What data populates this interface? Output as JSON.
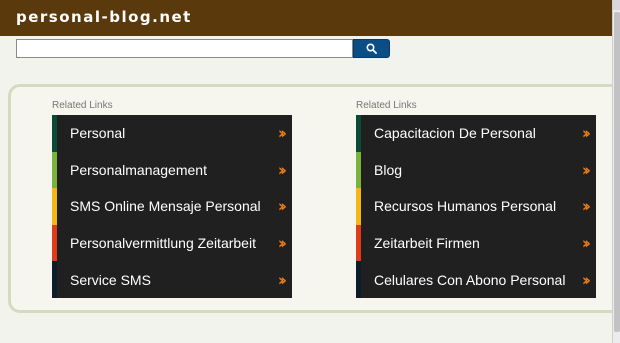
{
  "header": {
    "title": "personal-blog.net"
  },
  "search": {
    "value": "",
    "placeholder": ""
  },
  "colors": {
    "header_bg": "#5a3a0c",
    "search_button": "#0b4e86",
    "link_bg": "#202020",
    "arrow": "#ee7a16"
  },
  "columns": [
    {
      "title": "Related Links",
      "links": [
        {
          "label": "Personal",
          "accent": "#0b4a34"
        },
        {
          "label": "Personalmanagement",
          "accent": "#7db23a"
        },
        {
          "label": "SMS Online Mensaje Personal",
          "accent": "#f4b719"
        },
        {
          "label": "Personalvermittlung Zeitarbeit",
          "accent": "#de3d1c"
        },
        {
          "label": "Service SMS",
          "accent": "#0d1c2c"
        }
      ]
    },
    {
      "title": "Related Links",
      "links": [
        {
          "label": "Capacitacion De Personal",
          "accent": "#0b4a34"
        },
        {
          "label": "Blog",
          "accent": "#7db23a"
        },
        {
          "label": "Recursos Humanos Personal",
          "accent": "#f4b719"
        },
        {
          "label": "Zeitarbeit Firmen",
          "accent": "#de3d1c"
        },
        {
          "label": "Celulares Con Abono Personal",
          "accent": "#0d1c2c"
        }
      ]
    }
  ],
  "icons": {
    "search": "search-icon",
    "arrow": "double-chevron-right-icon"
  }
}
